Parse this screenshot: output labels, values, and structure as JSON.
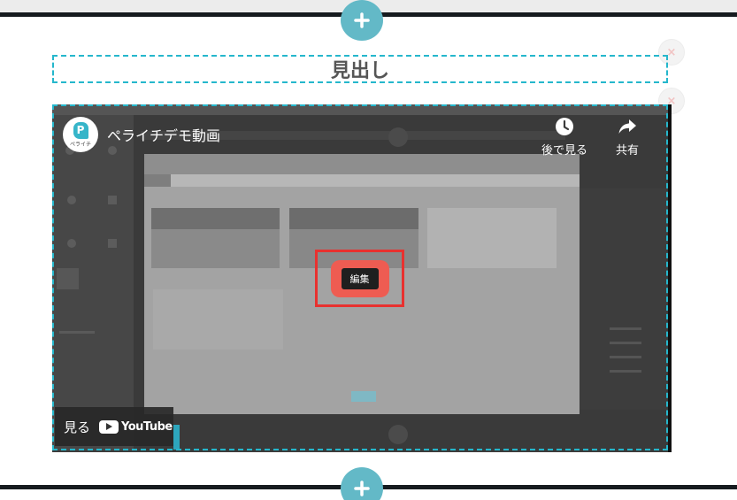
{
  "editor": {
    "heading_text": "見出し",
    "add_block_icon": "plus-icon",
    "remove_block_icon": "close-icon"
  },
  "video": {
    "channel_logo_text": "ペライチ",
    "title": "ペライチデモ動画",
    "watch_later_label": "後で見る",
    "share_label": "共有",
    "watch_on_label": "見る",
    "youtube_label": "YouTube",
    "edit_label": "編集"
  },
  "colors": {
    "accent_teal": "#25b7cc",
    "add_button": "#63b9c7",
    "highlight_red": "#e8312f",
    "divider": "#161b1f"
  }
}
